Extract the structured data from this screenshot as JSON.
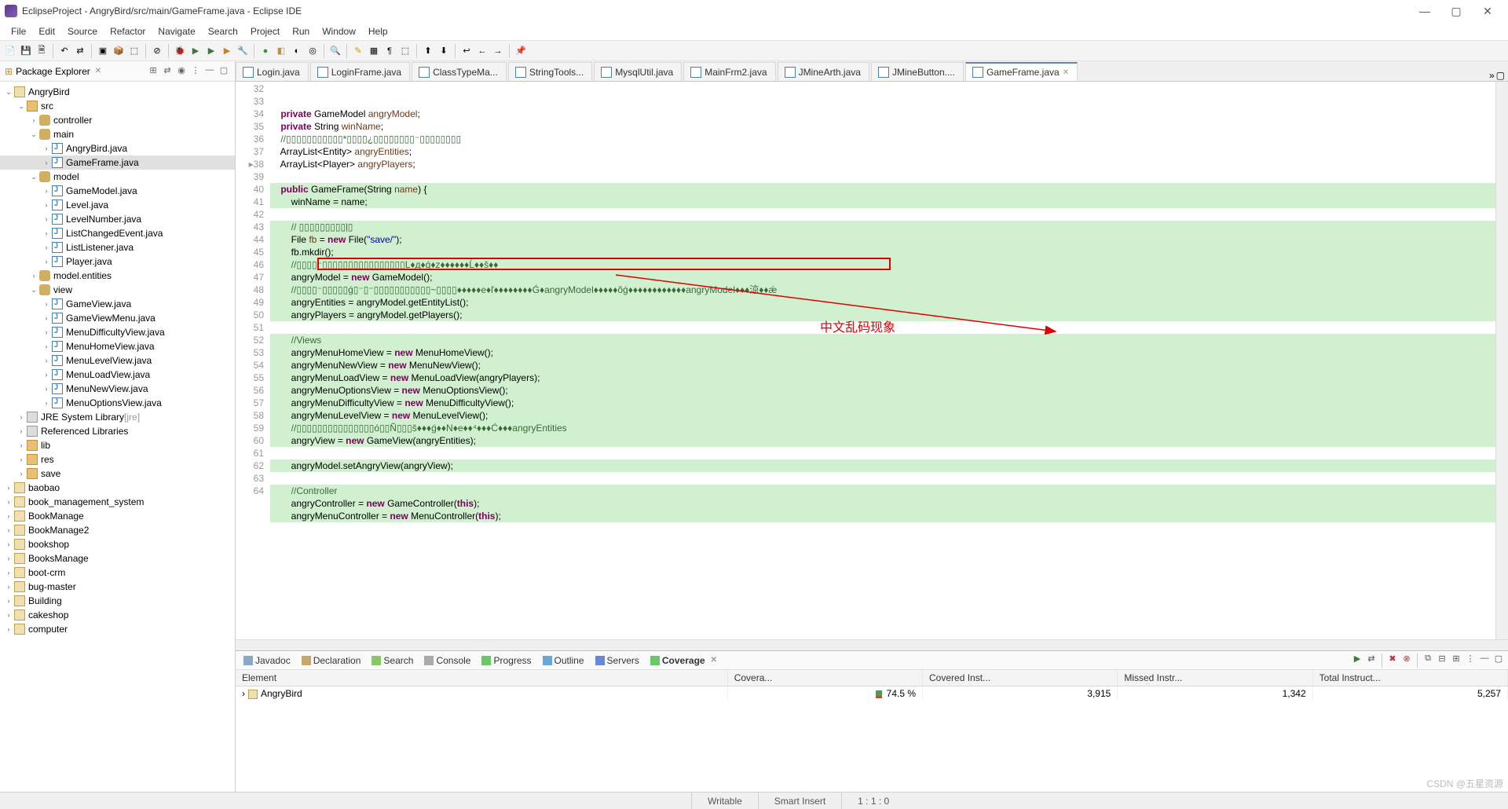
{
  "title": "EclipseProject - AngryBird/src/main/GameFrame.java - Eclipse IDE",
  "menus": [
    "File",
    "Edit",
    "Source",
    "Refactor",
    "Navigate",
    "Search",
    "Project",
    "Run",
    "Window",
    "Help"
  ],
  "packageExplorer": {
    "title": "Package Explorer",
    "nodes": [
      {
        "d": 0,
        "t": "v",
        "i": "proj",
        "l": "AngryBird"
      },
      {
        "d": 1,
        "t": "v",
        "i": "folder",
        "l": "src"
      },
      {
        "d": 2,
        "t": ">",
        "i": "pkg",
        "l": "controller"
      },
      {
        "d": 2,
        "t": "v",
        "i": "pkg",
        "l": "main"
      },
      {
        "d": 3,
        "t": ">",
        "i": "java",
        "l": "AngryBird.java"
      },
      {
        "d": 3,
        "t": ">",
        "i": "java",
        "l": "GameFrame.java",
        "sel": true
      },
      {
        "d": 2,
        "t": "v",
        "i": "pkg",
        "l": "model"
      },
      {
        "d": 3,
        "t": ">",
        "i": "java",
        "l": "GameModel.java"
      },
      {
        "d": 3,
        "t": ">",
        "i": "java",
        "l": "Level.java"
      },
      {
        "d": 3,
        "t": ">",
        "i": "java",
        "l": "LevelNumber.java"
      },
      {
        "d": 3,
        "t": ">",
        "i": "java",
        "l": "ListChangedEvent.java"
      },
      {
        "d": 3,
        "t": ">",
        "i": "java",
        "l": "ListListener.java"
      },
      {
        "d": 3,
        "t": ">",
        "i": "java",
        "l": "Player.java"
      },
      {
        "d": 2,
        "t": ">",
        "i": "pkg",
        "l": "model.entities"
      },
      {
        "d": 2,
        "t": "v",
        "i": "pkg",
        "l": "view"
      },
      {
        "d": 3,
        "t": ">",
        "i": "java",
        "l": "GameView.java"
      },
      {
        "d": 3,
        "t": ">",
        "i": "java",
        "l": "GameViewMenu.java"
      },
      {
        "d": 3,
        "t": ">",
        "i": "java",
        "l": "MenuDifficultyView.java"
      },
      {
        "d": 3,
        "t": ">",
        "i": "java",
        "l": "MenuHomeView.java"
      },
      {
        "d": 3,
        "t": ">",
        "i": "java",
        "l": "MenuLevelView.java"
      },
      {
        "d": 3,
        "t": ">",
        "i": "java",
        "l": "MenuLoadView.java"
      },
      {
        "d": 3,
        "t": ">",
        "i": "java",
        "l": "MenuNewView.java"
      },
      {
        "d": 3,
        "t": ">",
        "i": "java",
        "l": "MenuOptionsView.java"
      },
      {
        "d": 1,
        "t": ">",
        "i": "jar",
        "l": "JRE System Library ",
        "suffix": "[jre]"
      },
      {
        "d": 1,
        "t": ">",
        "i": "jar",
        "l": "Referenced Libraries"
      },
      {
        "d": 1,
        "t": ">",
        "i": "folder",
        "l": "lib"
      },
      {
        "d": 1,
        "t": ">",
        "i": "folder",
        "l": "res"
      },
      {
        "d": 1,
        "t": ">",
        "i": "folder",
        "l": "save"
      },
      {
        "d": 0,
        "t": ">",
        "i": "proj",
        "l": "baobao"
      },
      {
        "d": 0,
        "t": ">",
        "i": "proj",
        "l": "book_management_system"
      },
      {
        "d": 0,
        "t": ">",
        "i": "proj",
        "l": "BookManage"
      },
      {
        "d": 0,
        "t": ">",
        "i": "proj",
        "l": "BookManage2"
      },
      {
        "d": 0,
        "t": ">",
        "i": "proj",
        "l": "bookshop"
      },
      {
        "d": 0,
        "t": ">",
        "i": "proj",
        "l": "BooksManage"
      },
      {
        "d": 0,
        "t": ">",
        "i": "proj",
        "l": "boot-crm"
      },
      {
        "d": 0,
        "t": ">",
        "i": "proj",
        "l": "bug-master"
      },
      {
        "d": 0,
        "t": ">",
        "i": "proj",
        "l": "Building"
      },
      {
        "d": 0,
        "t": ">",
        "i": "proj",
        "l": "cakeshop"
      },
      {
        "d": 0,
        "t": ">",
        "i": "proj",
        "l": "computer"
      }
    ]
  },
  "editorTabs": [
    {
      "l": "Login.java"
    },
    {
      "l": "LoginFrame.java"
    },
    {
      "l": "ClassTypeMa..."
    },
    {
      "l": "StringTools..."
    },
    {
      "l": "MysqlUtil.java"
    },
    {
      "l": "MainFrm2.java"
    },
    {
      "l": "JMineArth.java"
    },
    {
      "l": "JMineButton...."
    },
    {
      "l": "GameFrame.java",
      "active": true
    }
  ],
  "code": {
    "start": 32,
    "lines": [
      {
        "n": 32,
        "hl": 0,
        "h": "    <span class='kw'>private</span> GameModel <span class='arg'>angryModel</span>;"
      },
      {
        "n": 33,
        "hl": 0,
        "h": "    <span class='kw'>private</span> String <span class='arg'>winName</span>;"
      },
      {
        "n": 34,
        "hl": 0,
        "h": "    <span class='cm'>//▯▯▯▯▯▯▯▯▯▯▯*▯▯▯▯¿▯▯▯▯▯▯▯▯⁻▯▯▯▯▯▯▯▯</span>"
      },
      {
        "n": 35,
        "hl": 0,
        "h": "    ArrayList&lt;Entity&gt; <span class='arg'>angryEntities</span>;"
      },
      {
        "n": 36,
        "hl": 0,
        "h": "    ArrayList&lt;Player&gt; <span class='arg'>angryPlayers</span>;"
      },
      {
        "n": 37,
        "hl": 0,
        "h": ""
      },
      {
        "n": 38,
        "hl": 1,
        "h": "    <span class='kw'>public</span> <span class='fn'>GameFrame</span>(String <span class='arg'>name</span>) {",
        "mark": "▸"
      },
      {
        "n": 39,
        "hl": 1,
        "h": "        winName = name;"
      },
      {
        "n": 40,
        "hl": 0,
        "h": ""
      },
      {
        "n": 41,
        "hl": 1,
        "h": "        <span class='cm'>// ▯▯▯▯▯▯▯▯▯ļ▯</span>"
      },
      {
        "n": 42,
        "hl": 1,
        "h": "        File <span class='arg'>fb</span> = <span class='kw'>new</span> File(<span class='str'>\"save/\"</span>);"
      },
      {
        "n": 43,
        "hl": 1,
        "h": "        fb.mkdir();"
      },
      {
        "n": 44,
        "hl": 1,
        "h": "        <span class='cm'>//▯▯▯▯⁻▯▯▯▯▯▯▯▯▯▯▯▯▯▯▯▯Ļ♦д♦ǵ♦z♦♦♦♦♦♦Ĺ♦♦š♦♦</span>"
      },
      {
        "n": 45,
        "hl": 1,
        "h": "        angryModel = <span class='kw'>new</span> GameModel();"
      },
      {
        "n": 46,
        "hl": 1,
        "h": "        <span class='cm'>//▯▯▯▯⁻▯▯▯▯▯ǵ▯⁻▯⁻▯▯▯▯▯▯▯▯▯▯▯~▯▯▯▯♦♦♦♦♦e♦ľ♦♦♦♦♦♦♦♦Ǵ♦angryModel♦♦♦♦♦õǵ♦♦♦♦♦♦♦♦♦♦♦♦angryModel♦♦♦涼♦♦ǽ</span>"
      },
      {
        "n": 47,
        "hl": 1,
        "h": "        angryEntities = angryModel.getEntityList();"
      },
      {
        "n": 48,
        "hl": 1,
        "h": "        angryPlayers = angryModel.getPlayers();"
      },
      {
        "n": 49,
        "hl": 0,
        "h": ""
      },
      {
        "n": 50,
        "hl": 1,
        "h": "        <span class='cm'>//Views</span>"
      },
      {
        "n": 51,
        "hl": 1,
        "h": "        angryMenuHomeView = <span class='kw'>new</span> MenuHomeView();"
      },
      {
        "n": 52,
        "hl": 1,
        "h": "        angryMenuNewView = <span class='kw'>new</span> MenuNewView();"
      },
      {
        "n": 53,
        "hl": 1,
        "h": "        angryMenuLoadView = <span class='kw'>new</span> MenuLoadView(angryPlayers);"
      },
      {
        "n": 54,
        "hl": 1,
        "h": "        angryMenuOptionsView = <span class='kw'>new</span> MenuOptionsView();"
      },
      {
        "n": 55,
        "hl": 1,
        "h": "        angryMenuDifficultyView = <span class='kw'>new</span> MenuDifficultyView();"
      },
      {
        "n": 56,
        "hl": 1,
        "h": "        angryMenuLevelView = <span class='kw'>new</span> MenuLevelView();"
      },
      {
        "n": 57,
        "hl": 1,
        "h": "        <span class='cm'>//▯▯▯▯▯▯▯▯▯▯▯▯▯▯▯ó▯▯Ñ▯▯▯š♦♦♦ǵ♦♦N♦e♦♦⁴♦♦♦Ć♦♦♦angryEntities</span>"
      },
      {
        "n": 58,
        "hl": 1,
        "h": "        angryView = <span class='kw'>new</span> GameView(angryEntities);"
      },
      {
        "n": 59,
        "hl": 0,
        "h": ""
      },
      {
        "n": 60,
        "hl": 1,
        "h": "        angryModel.setAngryView(angryView);"
      },
      {
        "n": 61,
        "hl": 0,
        "h": ""
      },
      {
        "n": 62,
        "hl": 1,
        "h": "        <span class='cm'>//Controller</span>"
      },
      {
        "n": 63,
        "hl": 1,
        "h": "        angryController = <span class='kw'>new</span> GameController(<span class='kw'>this</span>);"
      },
      {
        "n": 64,
        "hl": 1,
        "h": "        angryMenuController = <span class='kw'>new</span> MenuController(<span class='kw'>this</span>);"
      }
    ]
  },
  "annotation": "中文乱码现象",
  "bottomTabs": [
    "Javadoc",
    "Declaration",
    "Search",
    "Console",
    "Progress",
    "Outline",
    "Servers",
    "Coverage"
  ],
  "activeBottom": "Coverage",
  "coverage": {
    "headers": [
      "Element",
      "Covera...",
      "Covered Inst...",
      "Missed Instr...",
      "Total Instruct..."
    ],
    "rows": [
      {
        "el": "AngryBird",
        "cov": "74.5 %",
        "ci": "3,915",
        "mi": "1,342",
        "ti": "5,257"
      }
    ]
  },
  "status": {
    "writable": "Writable",
    "insert": "Smart Insert",
    "pos": "1 : 1 : 0"
  },
  "watermark": "CSDN @五星资源"
}
